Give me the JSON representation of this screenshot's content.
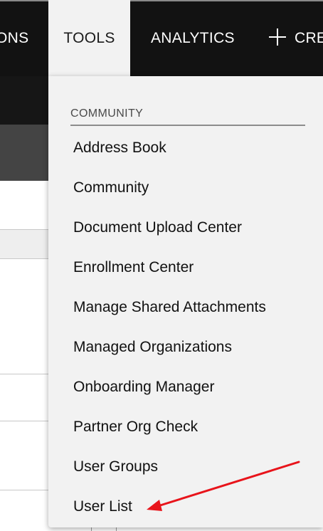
{
  "navbar": {
    "items": [
      {
        "label": "ONS"
      },
      {
        "label": "TOOLS"
      },
      {
        "label": "ANALYTICS"
      },
      {
        "label": "CRE"
      }
    ]
  },
  "dropdown": {
    "section_title": "COMMUNITY",
    "items": [
      {
        "label": "Address Book"
      },
      {
        "label": "Community"
      },
      {
        "label": "Document Upload Center"
      },
      {
        "label": "Enrollment Center"
      },
      {
        "label": "Manage Shared Attachments"
      },
      {
        "label": "Managed Organizations"
      },
      {
        "label": "Onboarding Manager"
      },
      {
        "label": "Partner Org Check"
      },
      {
        "label": "User Groups"
      },
      {
        "label": "User List"
      }
    ]
  },
  "annotation": {
    "arrow_color": "#e8141b",
    "points_to": "User List"
  },
  "colors": {
    "navbar_bg": "#121212",
    "menu_bg": "#f2f2f2",
    "active_tab_bg": "#f2f2f2"
  }
}
